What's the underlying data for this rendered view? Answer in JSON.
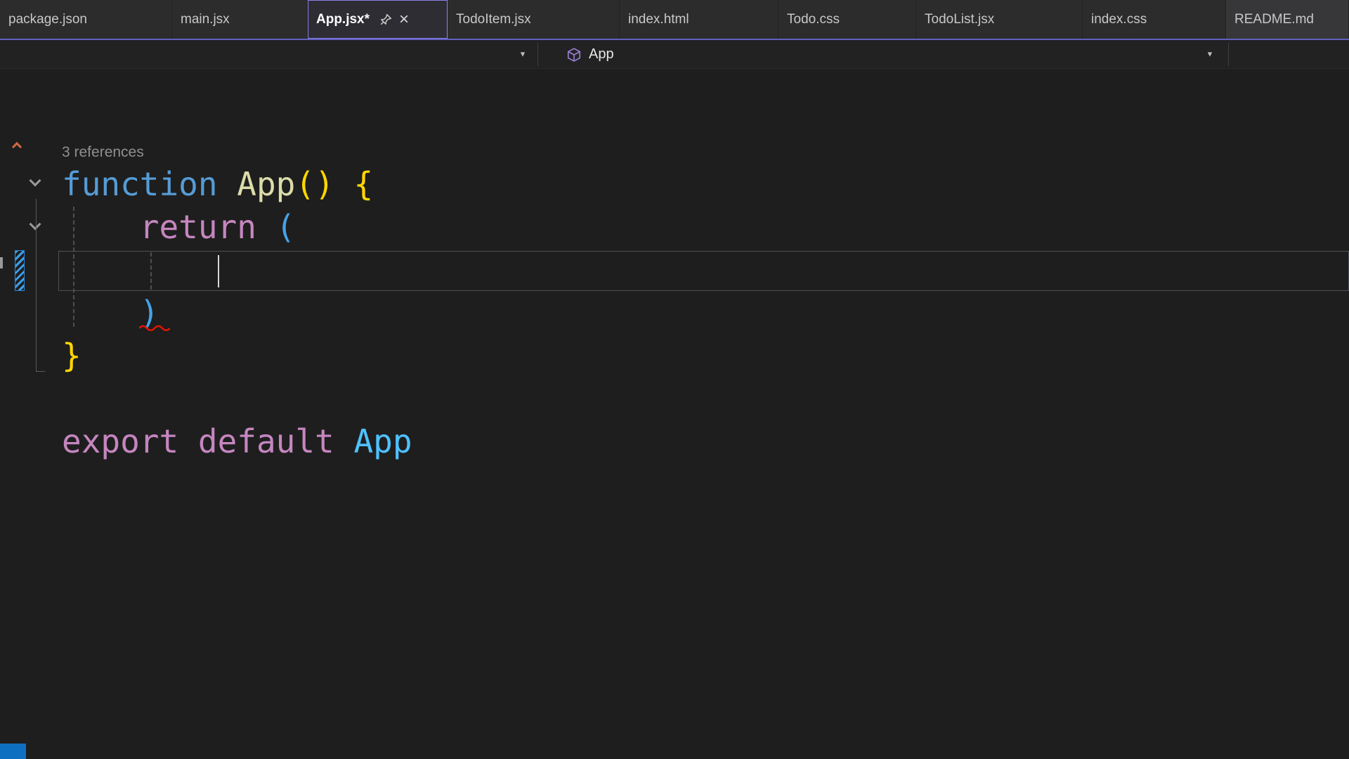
{
  "palette": {
    "editor_bg": "#1e1e1e",
    "tab_bar_bg": "#2c2c2d",
    "accent_underline": "#6360c0",
    "active_tab_outline": "#8d80e8",
    "status_blue": "#0e70c0",
    "error_red": "#e51400",
    "keyword_blue": "#569cd6",
    "keyword_pink": "#c586c0",
    "function_yellow": "#dcdcaa",
    "bracket_gold": "#ffd700",
    "bracket_blue": "#45a3e8",
    "identifier_blue": "#4fc1ff",
    "codelens_gray": "#8f8f8f"
  },
  "icons": {
    "close_glyph": "×",
    "dropdown_glyph": "▼"
  },
  "tab_bar": {
    "tabs": [
      {
        "label": "package.json"
      },
      {
        "label": "main.jsx"
      },
      {
        "label": "App.jsx*",
        "active": true,
        "modified": true
      },
      {
        "label": "TodoItem.jsx"
      },
      {
        "label": "index.html"
      },
      {
        "label": "Todo.css"
      },
      {
        "label": "TodoList.jsx"
      },
      {
        "label": "index.css"
      },
      {
        "label": "README.md",
        "light": true
      }
    ]
  },
  "nav_bar": {
    "member_label": "App"
  },
  "editor": {
    "codelens_text": "3 references",
    "code_lines": [
      {
        "tokens": [
          {
            "text": "function",
            "color": "#569cd6"
          },
          {
            "text": " "
          },
          {
            "text": "App",
            "color": "#dcdcaa"
          },
          {
            "text": "()",
            "color": "#ffd700"
          },
          {
            "text": " "
          },
          {
            "text": "{",
            "color": "#ffd700"
          }
        ]
      },
      {
        "tokens": [
          {
            "text": "    "
          },
          {
            "text": "return",
            "color": "#c586c0"
          },
          {
            "text": " "
          },
          {
            "text": "(",
            "color": "#45a3e8"
          }
        ]
      },
      {
        "current": true,
        "cursor_col": 8,
        "tokens": [
          {
            "text": "        "
          }
        ]
      },
      {
        "tokens": [
          {
            "text": "    "
          },
          {
            "text": ")",
            "color": "#45a3e8",
            "squiggle": true
          }
        ]
      },
      {
        "tokens": [
          {
            "text": "}",
            "color": "#ffd700"
          }
        ]
      },
      {
        "tokens": [
          {
            "text": ""
          }
        ]
      },
      {
        "tokens": [
          {
            "text": "export",
            "color": "#c586c0"
          },
          {
            "text": " "
          },
          {
            "text": "default",
            "color": "#c586c0"
          },
          {
            "text": " "
          },
          {
            "text": "App",
            "color": "#4fc1ff"
          }
        ]
      }
    ]
  }
}
